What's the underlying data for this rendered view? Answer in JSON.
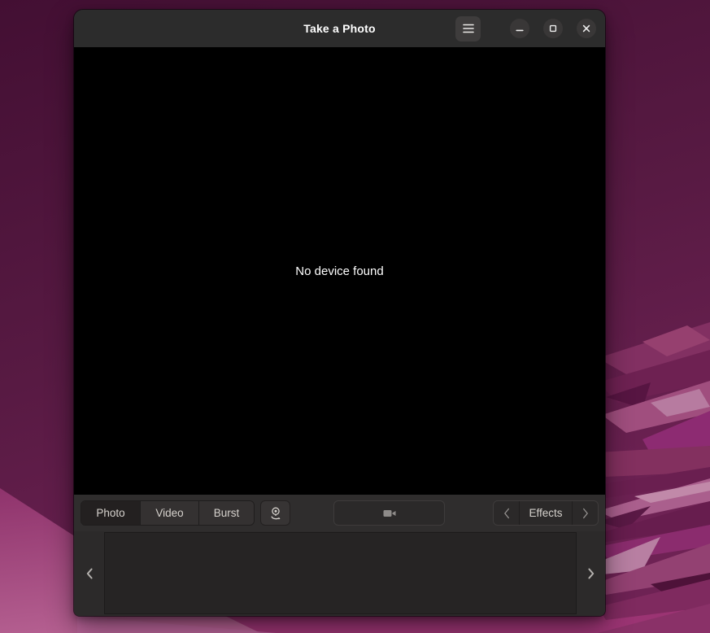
{
  "window": {
    "title": "Take a Photo",
    "controls": {
      "menu_icon": "hamburger-icon",
      "minimize_icon": "minimize-icon",
      "maximize_icon": "maximize-icon",
      "close_icon": "close-icon"
    }
  },
  "viewport": {
    "message": "No device found"
  },
  "toolbar": {
    "modes": [
      {
        "label": "Photo",
        "active": true
      },
      {
        "label": "Video",
        "active": false
      },
      {
        "label": "Burst",
        "active": false
      }
    ],
    "switch_camera_icon": "switch-camera-icon",
    "capture_icon": "video-camera-icon",
    "effects": {
      "label": "Effects",
      "prev_icon": "chevron-left-icon",
      "next_icon": "chevron-right-icon"
    }
  },
  "gallery": {
    "prev_icon": "chevron-left-icon",
    "next_icon": "chevron-right-icon",
    "thumbnails": []
  },
  "colors": {
    "titlebar_bg": "#2c2c2c",
    "viewport_bg": "#000000",
    "toolbar_bg": "#2f2d2d",
    "panel_bg": "#2c2a2a",
    "active_tab_bg": "#232020",
    "raised_button_bg": "#343131",
    "text": "#d6d2cd",
    "title_text": "#ffffff",
    "wallpaper_dark": "#451034",
    "wallpaper_magenta": "#9b3473"
  }
}
